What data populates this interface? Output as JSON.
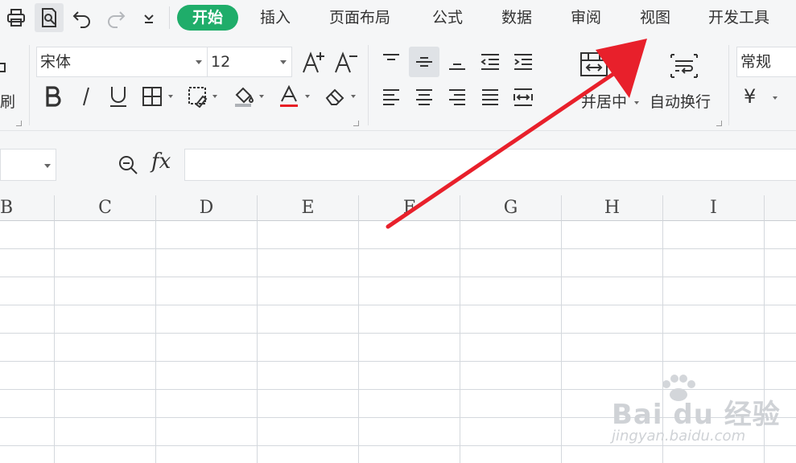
{
  "tabs": {
    "active": "开始",
    "items": [
      "插入",
      "页面布局",
      "公式",
      "数据",
      "审阅",
      "视图",
      "开发工具"
    ]
  },
  "ribbon": {
    "format_painter_label": "刷",
    "font_name": "宋体",
    "font_size": "12",
    "merge_label": "并居中",
    "wrap_label": "自动换行",
    "number_format": "常规",
    "currency_symbol": "¥"
  },
  "formula_bar": {
    "fx_label": "fx",
    "formula_value": ""
  },
  "sheet": {
    "columns": [
      "B",
      "C",
      "D",
      "E",
      "F",
      "G",
      "H",
      "I"
    ]
  },
  "watermark": {
    "brand": "Bai du 经验",
    "url": "jingyan.baidu.com"
  },
  "colors": {
    "active_tab": "#1fad6a",
    "annotation_arrow": "#e8202b",
    "font_color_bar": "#e81e25"
  }
}
